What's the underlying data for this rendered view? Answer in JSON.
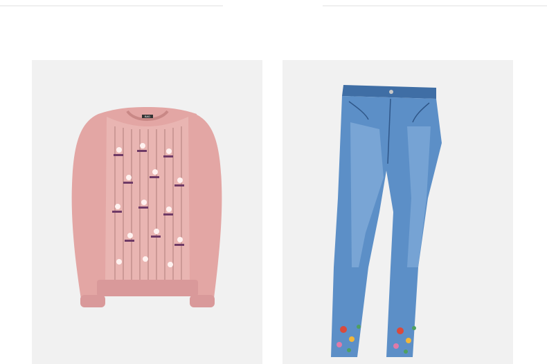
{
  "page": {
    "background": "#ffffff"
  },
  "products": [
    {
      "kind": "sweater",
      "icon": "pink-sweater-image",
      "colors": {
        "card": "#f1f1f1",
        "body": "#e3a6a4",
        "panel": "#e9b5b2",
        "shade": "#d1908f"
      },
      "label": "BAD"
    },
    {
      "kind": "jeans",
      "icon": "blue-jeans-image",
      "colors": {
        "card": "#f1f1f1",
        "denim": "#5c8fc7",
        "denim_light": "#8cb4de",
        "denim_dark": "#3f6ea5"
      }
    }
  ]
}
